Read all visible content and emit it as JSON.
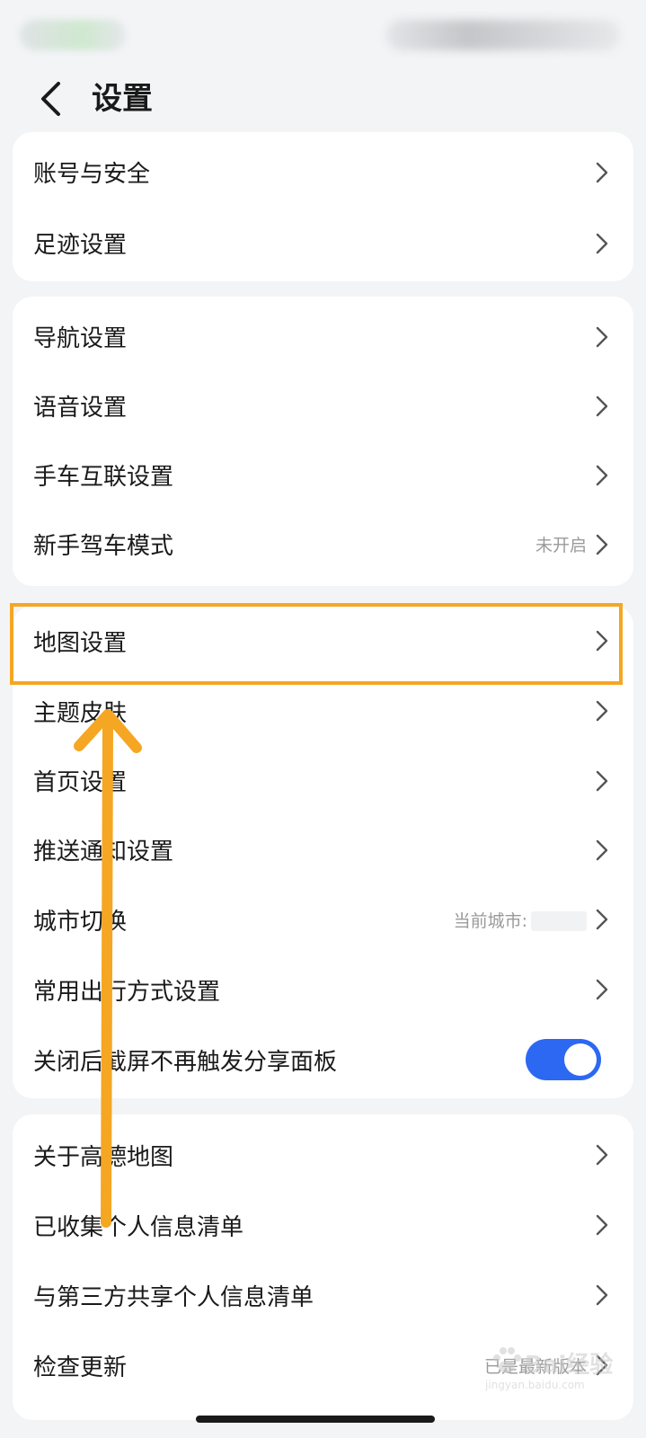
{
  "header": {
    "title": "设置"
  },
  "groups": [
    {
      "items": [
        {
          "label": "账号与安全"
        },
        {
          "label": "足迹设置"
        }
      ]
    },
    {
      "items": [
        {
          "label": "导航设置"
        },
        {
          "label": "语音设置"
        },
        {
          "label": "手车互联设置"
        },
        {
          "label": "新手驾车模式",
          "value": "未开启"
        }
      ]
    },
    {
      "items": [
        {
          "label": "地图设置"
        },
        {
          "label": "主题皮肤"
        },
        {
          "label": "首页设置"
        },
        {
          "label": "推送通知设置"
        },
        {
          "label": "城市切换",
          "value": "当前城市:"
        },
        {
          "label": "常用出行方式设置"
        },
        {
          "label": "关闭后截屏不再触发分享面板",
          "toggle_on": true
        }
      ]
    },
    {
      "items": [
        {
          "label": "关于高德地图"
        },
        {
          "label": "已收集个人信息清单"
        },
        {
          "label": "与第三方共享个人信息清单"
        },
        {
          "label": "检查更新",
          "value": "已是最新版本"
        }
      ]
    }
  ],
  "watermark": {
    "brand": "Bai经验",
    "url": "jingyan.baidu.com"
  },
  "colors": {
    "accent": "#2c68f2",
    "highlight": "#f5a623",
    "background": "#f3f4f6"
  }
}
